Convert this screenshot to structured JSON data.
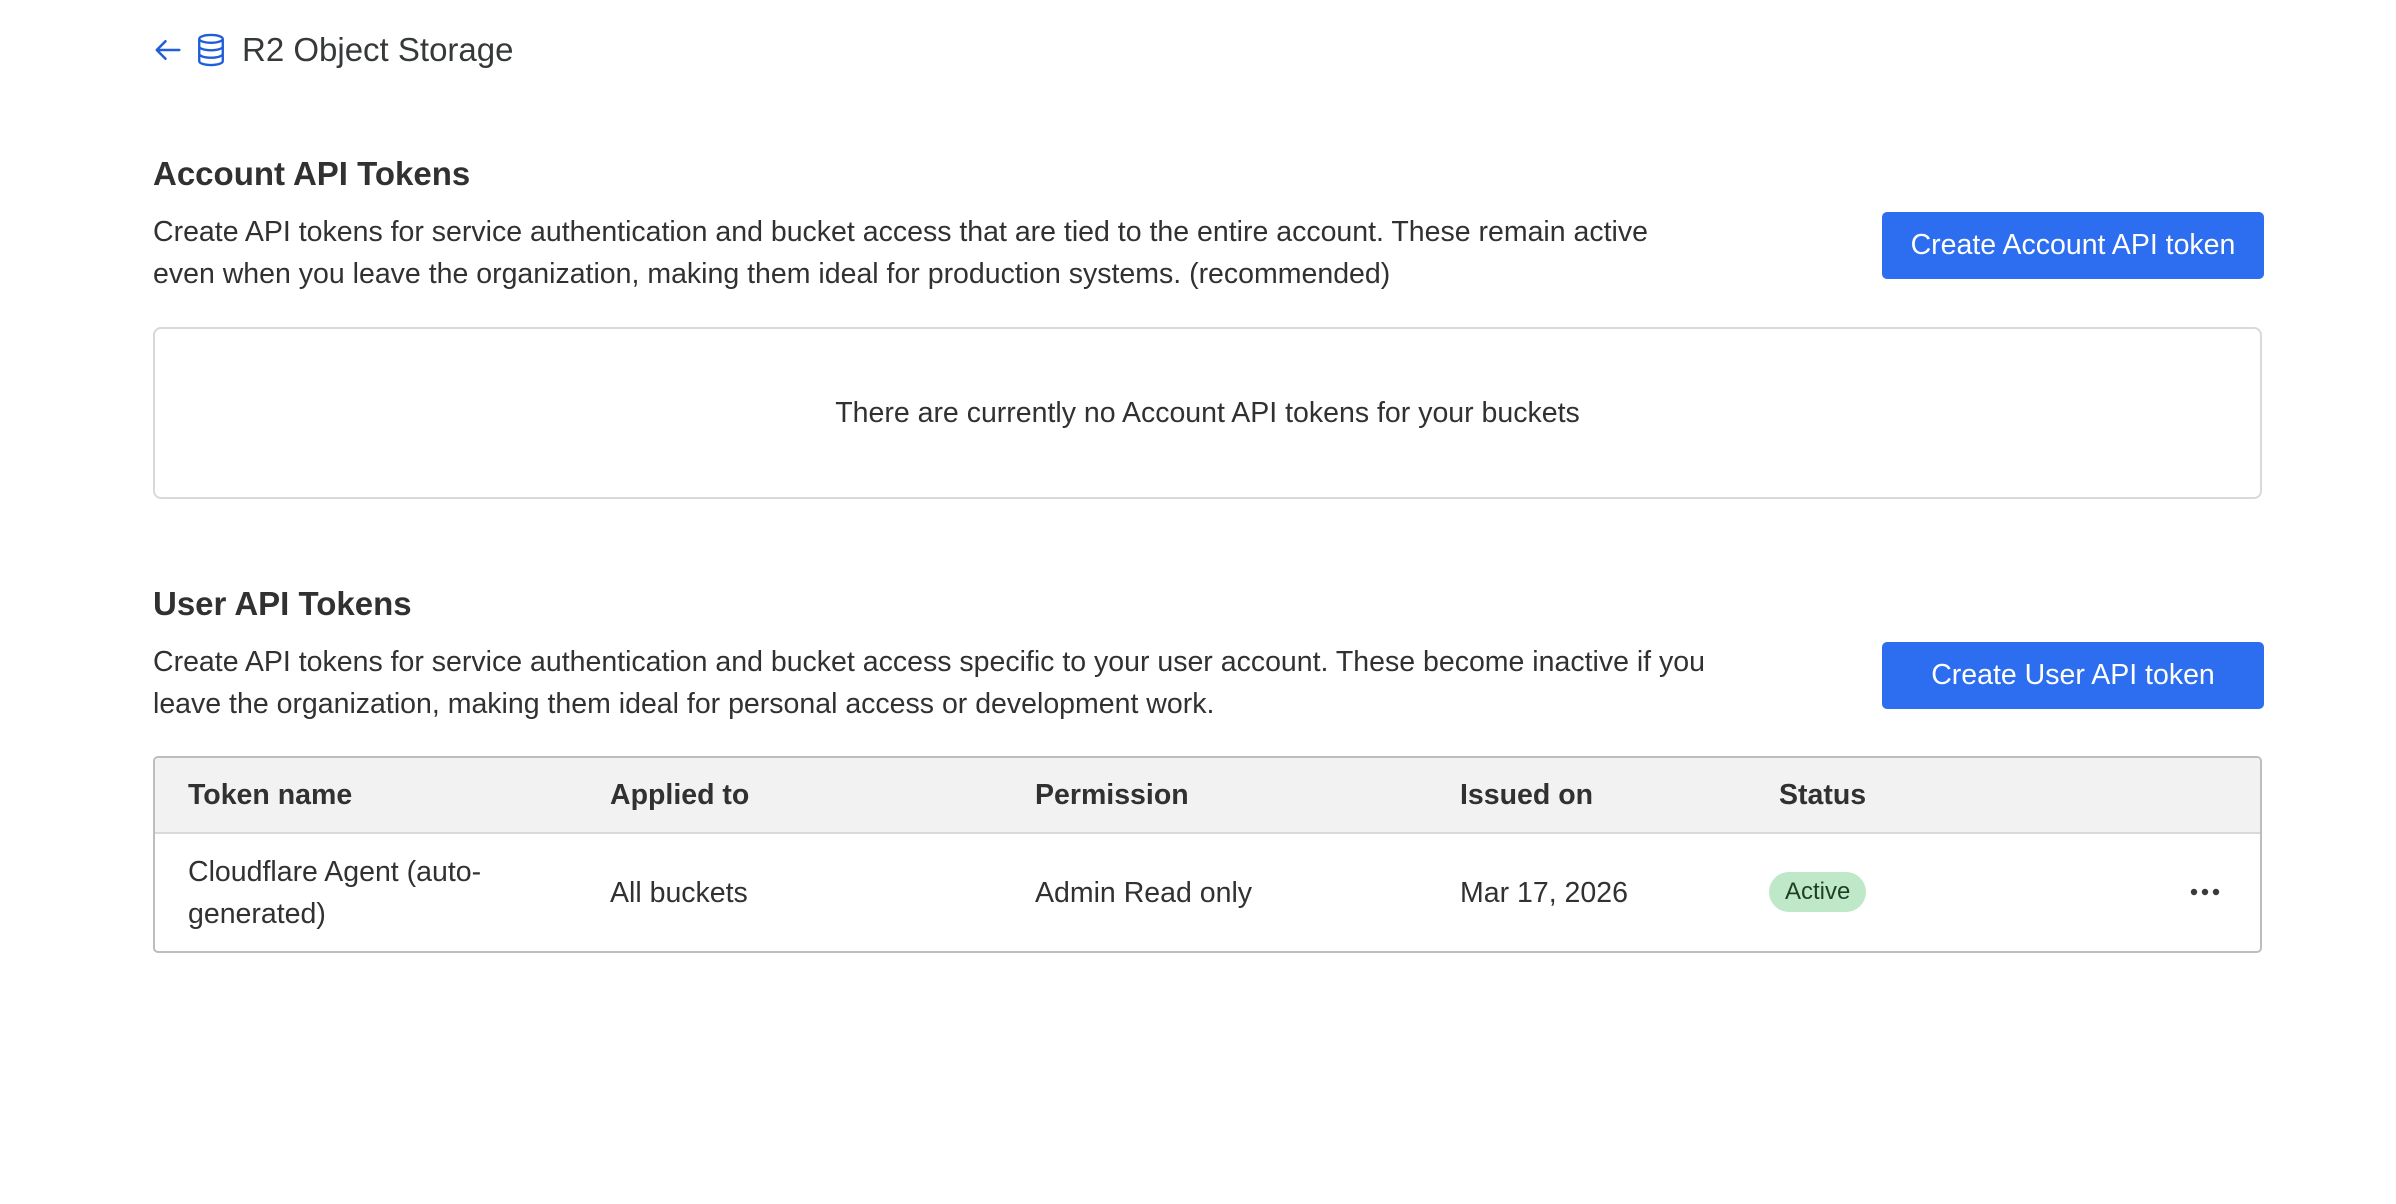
{
  "breadcrumb": {
    "title": "R2 Object Storage",
    "back_icon": "arrow-left-icon",
    "service_icon": "database-icon"
  },
  "account_section": {
    "title": "Account API Tokens",
    "description": "Create API tokens for service authentication and bucket access that are tied to the entire account. These remain active even when you leave the organization, making them ideal for production systems. (recommended)",
    "button_label": "Create Account API token",
    "empty_message": "There are currently no Account API tokens for your buckets"
  },
  "user_section": {
    "title": "User API Tokens",
    "description": "Create API tokens for service authentication and bucket access specific to your user account. These become inactive if you leave the organization, making them ideal for personal access or development work.",
    "button_label": "Create User API token",
    "table": {
      "columns": [
        "Token name",
        "Applied to",
        "Permission",
        "Issued on",
        "Status"
      ],
      "rows": [
        {
          "token_name": "Cloudflare Agent (auto-generated)",
          "applied_to": "All buckets",
          "permission": "Admin Read only",
          "issued_on": "Mar 17, 2026",
          "status": "Active",
          "actions_icon": "more-horizontal-icon"
        }
      ]
    }
  },
  "colors": {
    "accent": "#2c6eef",
    "status_active_bg": "#bfe8c8",
    "header_bg": "#f2f2f2",
    "text": "#313131"
  }
}
